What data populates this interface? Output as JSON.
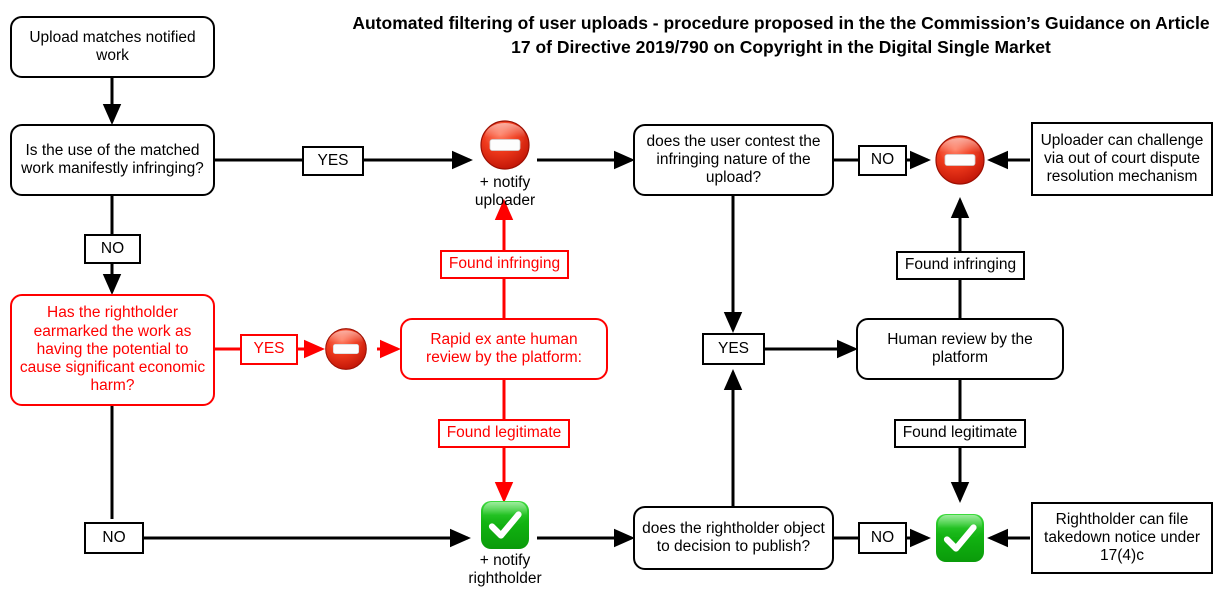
{
  "title": "Automated filtering of user uploads - procedure proposed in the the Commission’s Guidance on Article 17 of Directive 2019/790 on Copyright in the Digital Single Market",
  "colors": {
    "black": "#000000",
    "red": "#ff0000",
    "green": "#14b814",
    "stop_red": "#e32b15"
  },
  "nodes": {
    "upload_matches": "Upload matches notified work",
    "manifestly_infringing": "Is the use of the matched work manifestly infringing?",
    "earmarked": "Has the rightholder earmarked the work as having the potential to cause significant economic harm?",
    "rapid_review": "Rapid ex ante human review by the platform:",
    "user_contest": "does the user contest the infringing nature of the upload?",
    "human_review": "Human review by the platform",
    "rightholder_object": "does the rightholder object to decision to publish?",
    "uploader_challenge": "Uploader can challenge via out of court dispute resolution mechanism",
    "rightholder_takedown": "Rightholder can file takedown notice under 17(4)c"
  },
  "labels": {
    "yes_top": "YES",
    "no_left": "NO",
    "yes_earmarked": "YES",
    "no_bottom_left": "NO",
    "found_infringing_left": "Found infringing",
    "found_legitimate_left": "Found legitimate",
    "no_user_contest": "NO",
    "yes_user_contest": "YES",
    "found_infringing_right": "Found infringing",
    "found_legitimate_right": "Found legitimate",
    "no_rightholder_object": "NO"
  },
  "captions": {
    "notify_uploader": "+ notify\nuploader",
    "notify_rightholder": "+ notify\nrightholder"
  },
  "icons": {
    "stop_top": "no-entry-icon",
    "stop_mid": "no-entry-icon",
    "stop_right": "no-entry-icon",
    "check_bottom": "check-mark-icon",
    "check_right": "check-mark-icon"
  }
}
